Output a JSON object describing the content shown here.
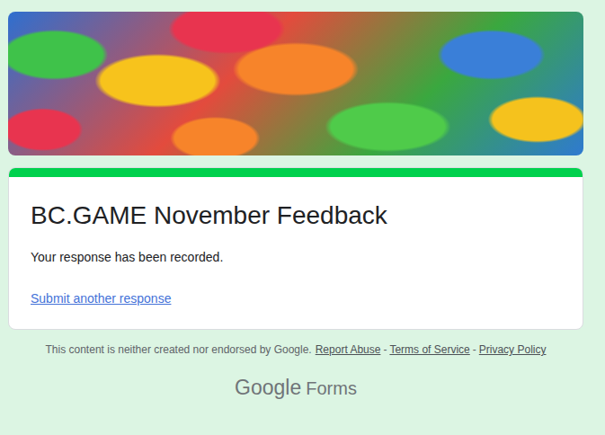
{
  "form": {
    "title": "BC.GAME November Feedback",
    "message": "Your response has been recorded.",
    "link": "Submit another response"
  },
  "footer": {
    "notice": "This content is neither created nor endorsed by Google.",
    "links": [
      "Report Abuse",
      "Terms of Service",
      "Privacy Policy"
    ],
    "separator": "-"
  },
  "brand": {
    "google": "Google",
    "product": "Forms"
  }
}
